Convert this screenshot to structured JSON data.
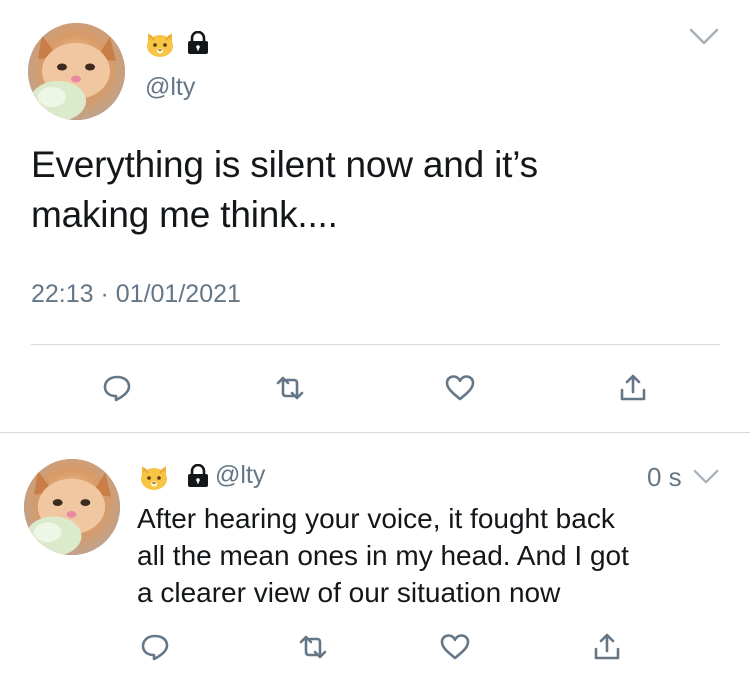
{
  "main_tweet": {
    "handle": "@lty",
    "text_line1": "Everything is silent now and it’s",
    "text_line2": "making me think....",
    "timestamp": "22:13 · 01/01/2021"
  },
  "reply_tweet": {
    "handle": "@lty",
    "time": "0 s",
    "text_line1": "After hearing your voice, it fought back",
    "text_line2": "all the mean ones in my head. And I got",
    "text_line3": "a clearer view of our situation now"
  },
  "colors": {
    "text_primary": "#14171a",
    "text_secondary": "#657786",
    "divider": "#d7dadd",
    "icon": "#657786",
    "icon_blue": "#1da1f2"
  },
  "icons": {
    "name_emoji": "cat-face-icon",
    "protected": "lock-icon",
    "menu": "chevron-down-icon",
    "reply": "comment-icon",
    "retweet": "retweet-icon",
    "like": "heart-icon",
    "share": "share-icon"
  }
}
